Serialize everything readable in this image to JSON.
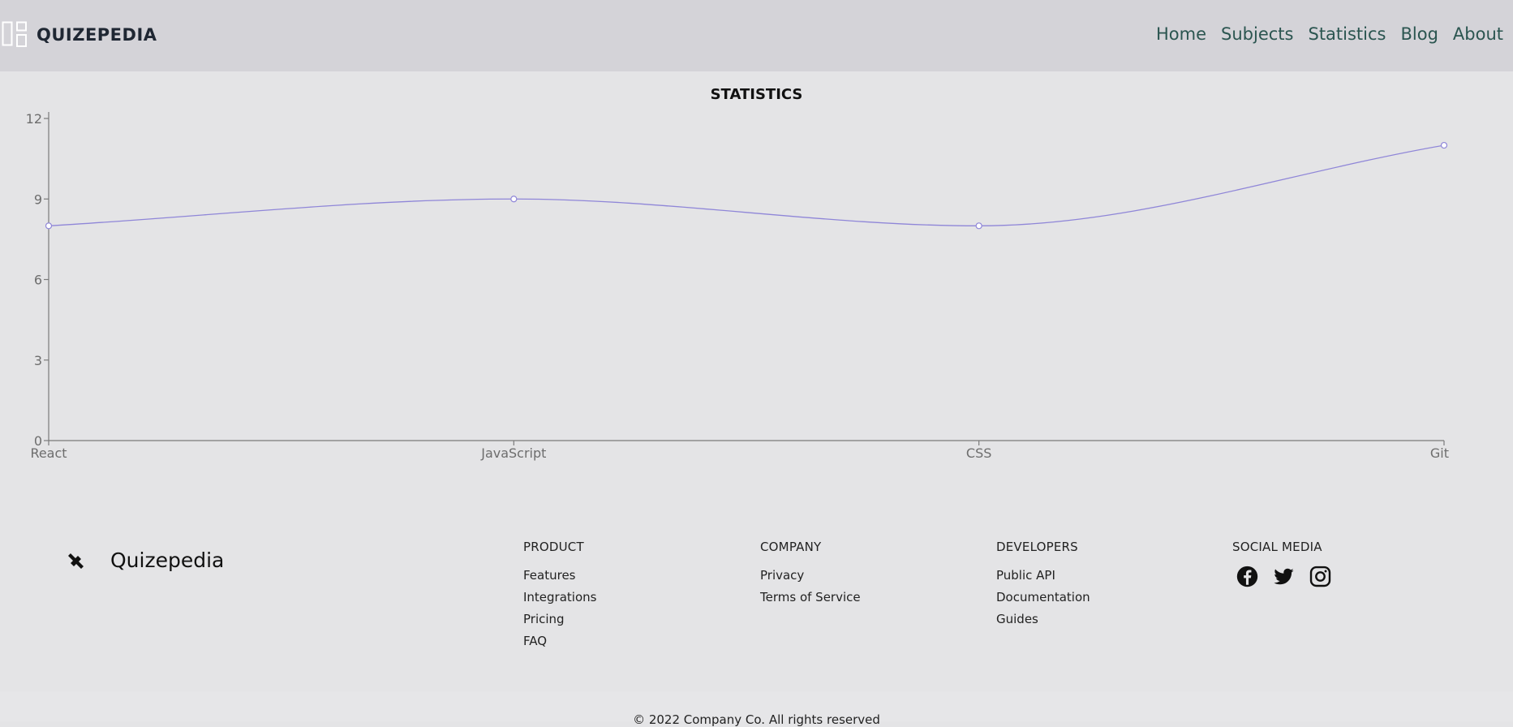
{
  "header": {
    "brand_name": "QUIZEPEDIA",
    "nav": [
      "Home",
      "Subjects",
      "Statistics",
      "Blog",
      "About"
    ]
  },
  "chart_title": "STATISTICS",
  "chart_data": {
    "type": "line",
    "categories": [
      "React",
      "JavaScript",
      "CSS",
      "Git"
    ],
    "values": [
      8,
      9,
      8,
      11
    ],
    "ylim": [
      0,
      12
    ],
    "yticks": [
      0,
      3,
      6,
      9,
      12
    ],
    "line_color": "#8f86d8",
    "grid": false,
    "curve": "monotone"
  },
  "footer": {
    "logo_name": "Quizepedia",
    "columns": [
      {
        "title": "PRODUCT",
        "links": [
          "Features",
          "Integrations",
          "Pricing",
          "FAQ"
        ]
      },
      {
        "title": "COMPANY",
        "links": [
          "Privacy",
          "Terms of Service"
        ]
      },
      {
        "title": "DEVELOPERS",
        "links": [
          "Public API",
          "Documentation",
          "Guides"
        ]
      }
    ],
    "social_title": "SOCIAL MEDIA",
    "social_icons": [
      "facebook-icon",
      "twitter-icon",
      "instagram-icon"
    ],
    "copyright": "© 2022 Company Co. All rights reserved"
  },
  "colors": {
    "header_bg": "#d4d3d8",
    "page_bg": "#e4e4e6",
    "nav_link": "#2b5550"
  }
}
